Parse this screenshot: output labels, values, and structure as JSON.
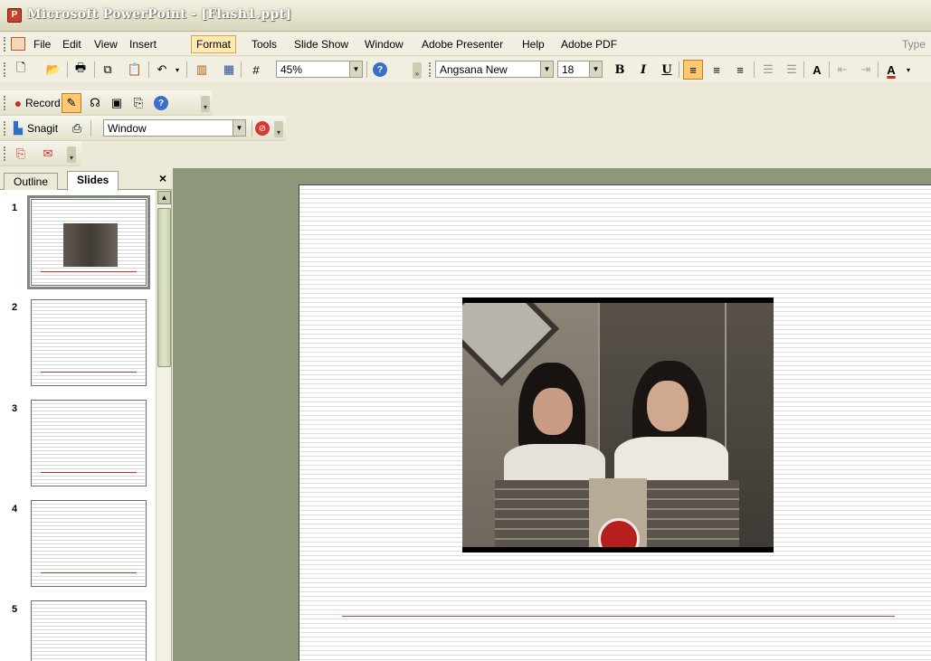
{
  "window": {
    "title": "Microsoft PowerPoint - [Flash1.ppt]"
  },
  "menu": {
    "items": [
      "File",
      "Edit",
      "View",
      "Insert",
      "Format",
      "Tools",
      "Slide Show",
      "Window",
      "Adobe Presenter",
      "Help",
      "Adobe PDF"
    ],
    "active": "Format",
    "type_question": "Type"
  },
  "standard_toolbar": {
    "zoom": "45%"
  },
  "formatting_toolbar": {
    "font": "Angsana New",
    "size": "18",
    "bold": "B",
    "italic": "I",
    "underline": "U",
    "font_color": "A"
  },
  "presenter_toolbar": {
    "record_label": "Record"
  },
  "snagit_toolbar": {
    "snagit_label": "Snagit",
    "capture_mode": "Window"
  },
  "left_pane": {
    "tabs": [
      "Outline",
      "Slides"
    ],
    "active_tab": "Slides",
    "close": "×",
    "slides": [
      {
        "number": "1",
        "has_picture": true
      },
      {
        "number": "2",
        "has_picture": false
      },
      {
        "number": "3",
        "has_picture": false
      },
      {
        "number": "4",
        "has_picture": false
      },
      {
        "number": "5",
        "has_picture": false
      }
    ],
    "selected_slide": "1"
  },
  "colors": {
    "title_underline": "#d23a33",
    "workspace_bg": "#8d977a",
    "selected_border": "#7c8a7c"
  }
}
